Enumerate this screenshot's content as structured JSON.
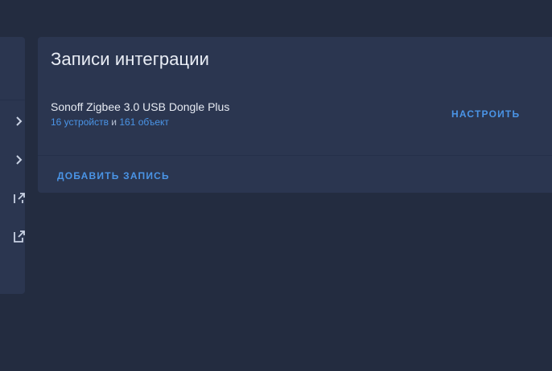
{
  "left_panel": {
    "icons": [
      "chevron-right-icon",
      "chevron-right-icon",
      "open-in-new-icon",
      "open-in-new-icon"
    ]
  },
  "integration_card": {
    "title": "Записи интеграции",
    "entry": {
      "name": "Sonoff Zigbee 3.0 USB Dongle Plus",
      "devices_link": "16 устройств",
      "connector": " и ",
      "entities_link": "161 объект"
    },
    "configure_label": "НАСТРОИТЬ",
    "add_entry_label": "ДОБАВИТЬ ЗАПИСЬ"
  },
  "colors": {
    "background": "#232c40",
    "card": "#2b3650",
    "accent": "#4a94e6",
    "text": "#e6eaf2"
  }
}
